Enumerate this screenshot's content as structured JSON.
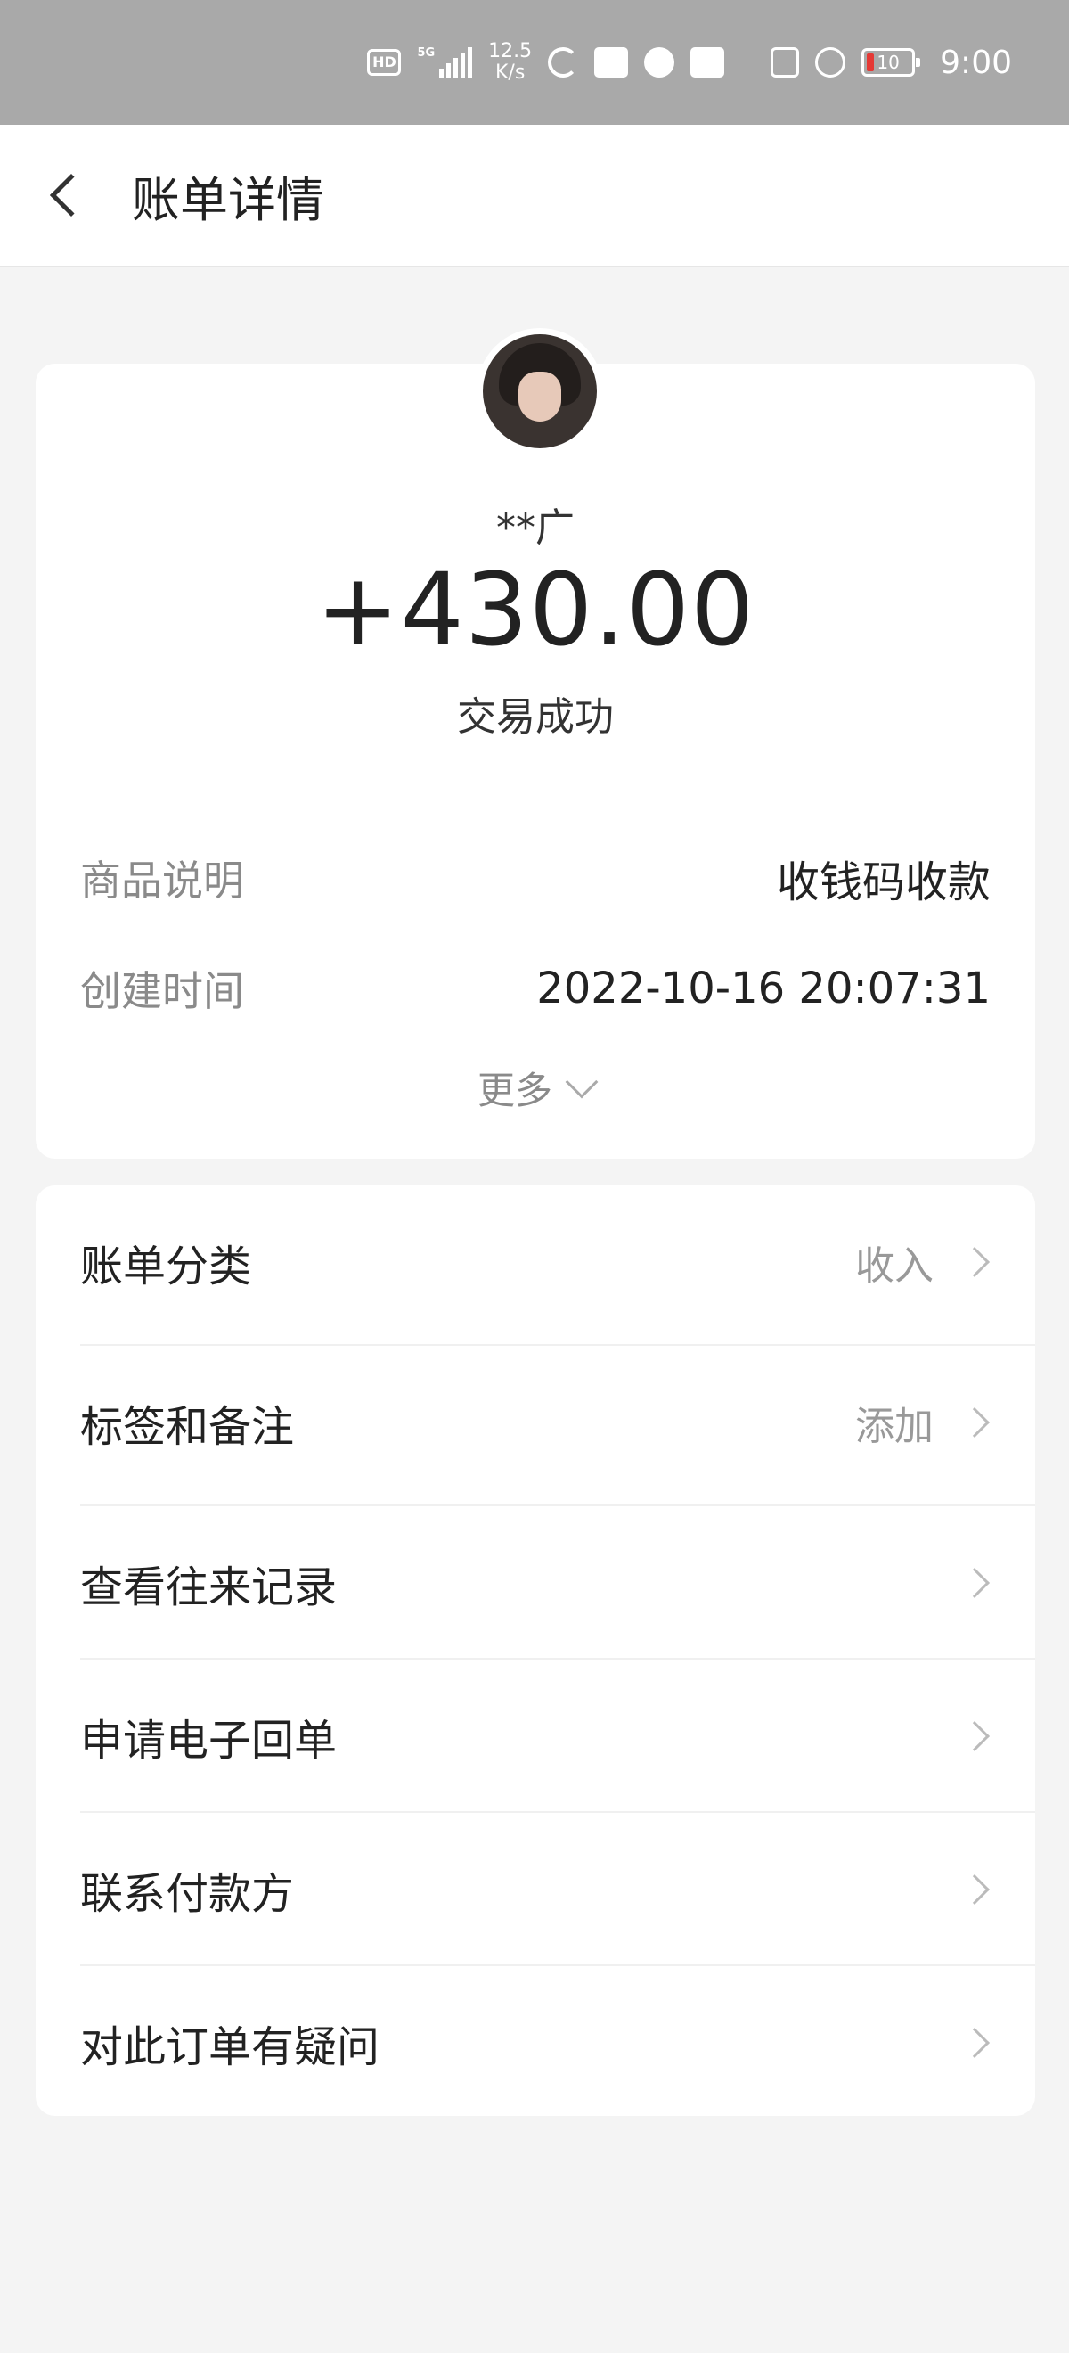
{
  "status_bar": {
    "hd": "HD",
    "network": "5G",
    "speed_value": "12.5",
    "speed_unit": "K/s",
    "battery": "10",
    "time": "9:00",
    "icons": [
      "hd-icon",
      "signal-icon",
      "loading-icon",
      "message-icon",
      "voice-icon",
      "message-icon",
      "nfc-icon",
      "alarm-icon",
      "battery-icon"
    ]
  },
  "header": {
    "title": "账单详情"
  },
  "summary": {
    "payer_name": "**广",
    "amount": "+430.00",
    "status": "交易成功",
    "details": [
      {
        "label": "商品说明",
        "value": "收钱码收款"
      },
      {
        "label": "创建时间",
        "value": "2022-10-16 20:07:31"
      }
    ],
    "more_label": "更多"
  },
  "actions": [
    {
      "label": "账单分类",
      "value": "收入"
    },
    {
      "label": "标签和备注",
      "value": "添加"
    },
    {
      "label": "查看往来记录",
      "value": ""
    },
    {
      "label": "申请电子回单",
      "value": ""
    },
    {
      "label": "联系付款方",
      "value": ""
    },
    {
      "label": "对此订单有疑问",
      "value": ""
    }
  ]
}
